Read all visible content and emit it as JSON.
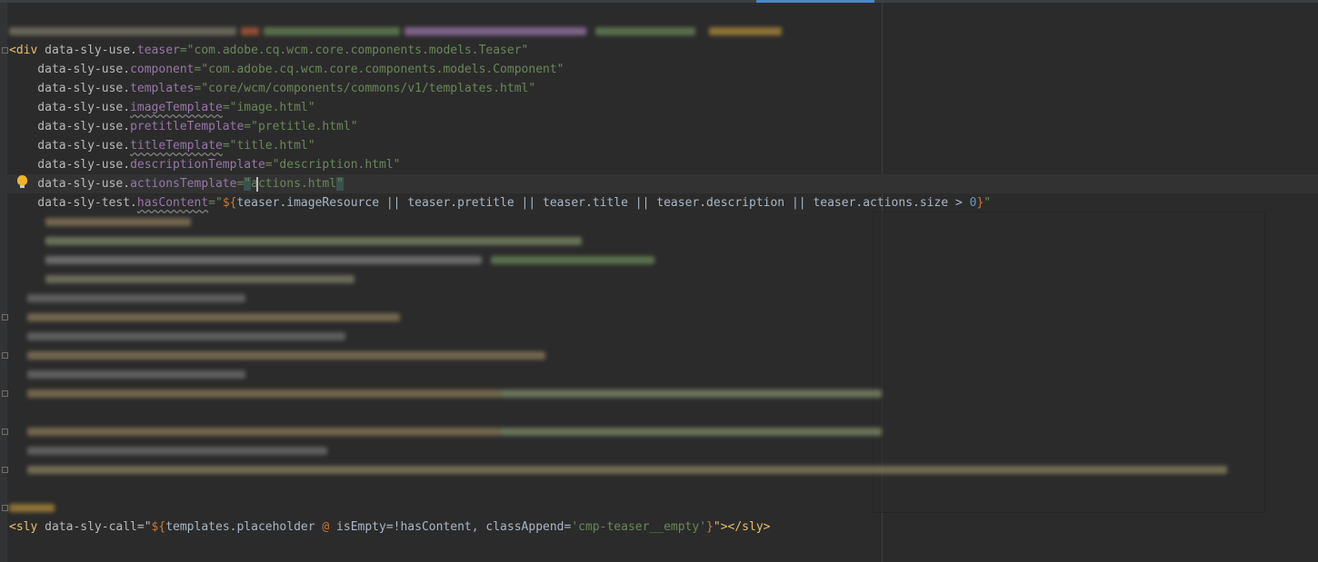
{
  "editor": {
    "lines": [
      {
        "parts": [
          {
            "t": "<div",
            "c": "tag"
          },
          {
            "t": " data-sly-use.",
            "c": "attr"
          },
          {
            "t": "teaser",
            "c": "prop"
          },
          {
            "t": "=\"com.adobe.cq.wcm.core.components.models.Teaser\"",
            "c": "str"
          }
        ]
      },
      {
        "parts": [
          {
            "t": "    data-sly-use.",
            "c": "attr"
          },
          {
            "t": "component",
            "c": "prop"
          },
          {
            "t": "=\"com.adobe.cq.wcm.core.components.models.Component\"",
            "c": "str"
          }
        ]
      },
      {
        "parts": [
          {
            "t": "    data-sly-use.",
            "c": "attr"
          },
          {
            "t": "templates",
            "c": "prop"
          },
          {
            "t": "=\"core/wcm/components/commons/v1/templates.html\"",
            "c": "str"
          }
        ]
      },
      {
        "parts": [
          {
            "t": "    data-sly-use.",
            "c": "attr"
          },
          {
            "t": "imageTemplate",
            "c": "prop squig"
          },
          {
            "t": "=\"image.html\"",
            "c": "str"
          }
        ]
      },
      {
        "parts": [
          {
            "t": "    data-sly-use.",
            "c": "attr"
          },
          {
            "t": "pretitleTemplate",
            "c": "prop"
          },
          {
            "t": "=\"pretitle.html\"",
            "c": "str"
          }
        ]
      },
      {
        "parts": [
          {
            "t": "    data-sly-use.",
            "c": "attr"
          },
          {
            "t": "titleTemplate",
            "c": "prop squig"
          },
          {
            "t": "=\"title.html\"",
            "c": "str"
          }
        ]
      },
      {
        "parts": [
          {
            "t": "    data-sly-use.",
            "c": "attr"
          },
          {
            "t": "descriptionTemplate",
            "c": "prop"
          },
          {
            "t": "=\"description.html\"",
            "c": "str"
          }
        ]
      },
      {
        "parts": [
          {
            "t": "    data-sly-use.",
            "c": "attr"
          },
          {
            "t": "actionsTemplate",
            "c": "prop"
          },
          {
            "t": "=",
            "c": "str"
          },
          {
            "t": "\"",
            "c": "str hl-quote"
          },
          {
            "t": "actions.html",
            "c": "str"
          },
          {
            "t": "\"",
            "c": "str hl-quote"
          }
        ]
      },
      {
        "parts": [
          {
            "t": "    data-sly-test.",
            "c": "attr"
          },
          {
            "t": "hasContent",
            "c": "prop squig"
          },
          {
            "t": "=\"",
            "c": "str"
          },
          {
            "t": "${",
            "c": "expr"
          },
          {
            "t": "teaser.imageResource || teaser.pretitle || teaser.title || teaser.description || teaser.actions.size > ",
            "c": "plain"
          },
          {
            "t": "0",
            "c": "num"
          },
          {
            "t": "}",
            "c": "expr"
          },
          {
            "t": "\"",
            "c": "str"
          }
        ]
      }
    ],
    "last_line": {
      "parts": [
        {
          "t": "<sly",
          "c": "tag"
        },
        {
          "t": " data-sly-call=\"",
          "c": "attr"
        },
        {
          "t": "${",
          "c": "expr"
        },
        {
          "t": "templates.placeholder ",
          "c": "plain"
        },
        {
          "t": "@",
          "c": "expr"
        },
        {
          "t": " isEmpty=!hasContent, classAppend=",
          "c": "plain"
        },
        {
          "t": "'cmp-teaser__empty'",
          "c": "str"
        },
        {
          "t": "}",
          "c": "expr"
        },
        {
          "t": "\"></sly>",
          "c": "tag"
        }
      ]
    }
  }
}
